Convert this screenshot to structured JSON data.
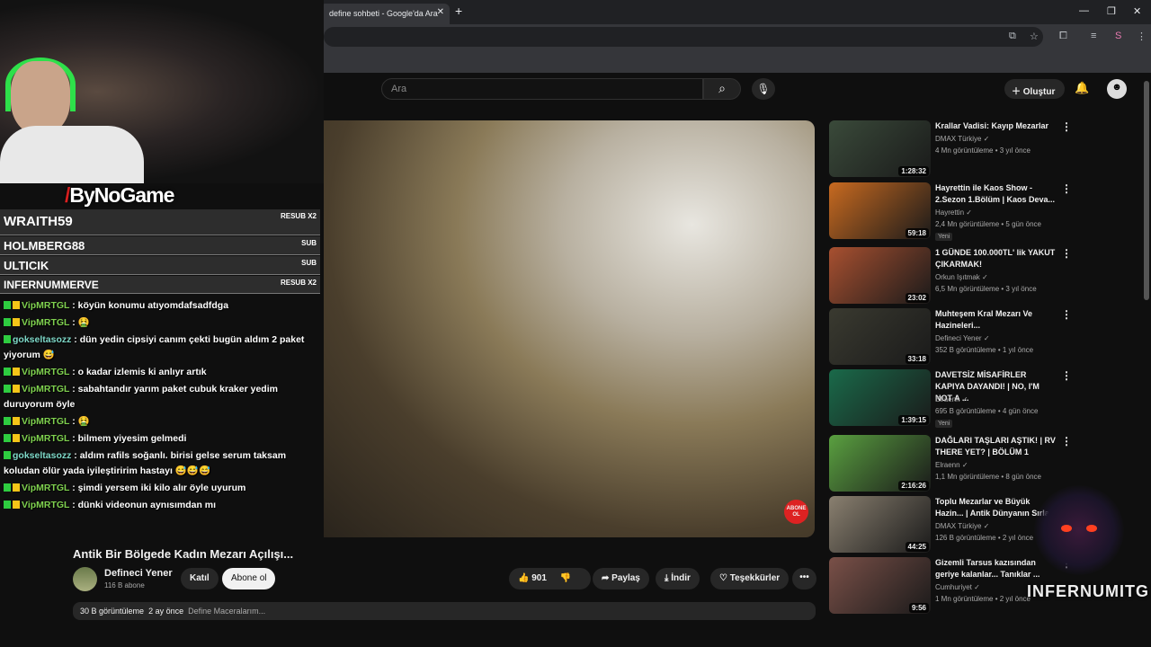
{
  "browser": {
    "tab_title": "define sohbeti - Google'da Ara",
    "tab_close": "✕",
    "new_tab": "+"
  },
  "youtube": {
    "search_placeholder": "Ara",
    "create_label": "Oluştur"
  },
  "video": {
    "title": "Antik Bir Bölgede Kadın Mezarı Açılışı...",
    "channel": "Defineci Yener",
    "subscribers": "116 B abone",
    "join_label": "Katıl",
    "subscribe_label": "Abone ol",
    "likes": "901",
    "share_label": "Paylaş",
    "download_label": "İndir",
    "thanks_label": "Teşekkürler",
    "views": "30 B görüntüleme",
    "age": "2 ay önce",
    "description": "Define Maceralarım...",
    "overlay_badge": "ABONE OL"
  },
  "recommendations": [
    {
      "title": "Krallar Vadisi: Kayıp Mezarlar",
      "channel": "DMAX Türkiye",
      "meta": "4 Mn görüntüleme • 3 yıl önce",
      "duration": "1:28:32",
      "badge": "",
      "thumb": "#3a4a3a"
    },
    {
      "title": "Hayrettin ile Kaos Show - 2.Sezon 1.Bölüm | Kaos Deva...",
      "channel": "Hayrettin",
      "meta": "2,4 Mn görüntüleme • 5 gün önce",
      "duration": "59:18",
      "badge": "Yeni",
      "thumb": "#c86a20"
    },
    {
      "title": "1 GÜNDE 100.000TL' lik YAKUT ÇIKARMAK!",
      "channel": "Orkun Işıtmak",
      "meta": "6,5 Mn görüntüleme • 3 yıl önce",
      "duration": "23:02",
      "badge": "",
      "thumb": "#a85030"
    },
    {
      "title": "Muhteşem Kral Mezarı Ve Hazineleri...",
      "channel": "Defineci Yener",
      "meta": "352 B görüntüleme • 1 yıl önce",
      "duration": "33:18",
      "badge": "",
      "thumb": "#3a3a30"
    },
    {
      "title": "DAVETSİZ MİSAFİRLER KAPIYA DAYANDI! | NO, I'M NOT A ...",
      "channel": "Elraenn",
      "meta": "695 B görüntüleme • 4 gün önce",
      "duration": "1:39:15",
      "badge": "Yeni",
      "thumb": "#1a6a4a"
    },
    {
      "title": "DAĞLARI TAŞLARI AŞTIK! | RV THERE YET? | BÖLÜM 1",
      "channel": "Elraenn",
      "meta": "1,1 Mn görüntüleme • 8 gün önce",
      "duration": "2:16:26",
      "badge": "",
      "thumb": "#5aa040"
    },
    {
      "title": "Toplu Mezarlar ve Büyük Hazin... | Antik Dünyanın Sırları",
      "channel": "DMAX Türkiye",
      "meta": "126 B görüntüleme • 2 yıl önce",
      "duration": "44:25",
      "badge": "",
      "thumb": "#8a8070"
    },
    {
      "title": "Gizemli Tarsus kazısından geriye kalanlar... Tanıklar ...",
      "channel": "Cumhuriyet",
      "meta": "1 Mn görüntüleme • 2 yıl önce",
      "duration": "9:56",
      "badge": "",
      "thumb": "#7a5048"
    }
  ],
  "stream": {
    "brand_prefix": "/",
    "brand": "ByNoGame",
    "events": [
      {
        "name": "WRAITH59",
        "tag": "RESUB X2"
      },
      {
        "name": "HOLMBERG88",
        "tag": "SUB"
      },
      {
        "name": "ULTICIK",
        "tag": "SUB"
      },
      {
        "name": "INFERNUMMERVE",
        "tag": "RESUB X2"
      }
    ],
    "chat": [
      {
        "user": "VipMRTGL",
        "badges": [
          "g",
          "y"
        ],
        "cls": "u1",
        "text": " : köyün konumu atıyomdafsadfdga"
      },
      {
        "user": "VipMRTGL",
        "badges": [
          "g",
          "y"
        ],
        "cls": "u1",
        "text": " : 🤮"
      },
      {
        "user": "gokseltasozz",
        "badges": [
          "g"
        ],
        "cls": "u2",
        "text": " : dün yedin cipsiyi canım çekti bugün aldım 2 paket yiyorum 😅"
      },
      {
        "user": "VipMRTGL",
        "badges": [
          "g",
          "y"
        ],
        "cls": "u1",
        "text": " : o kadar izlemis ki anlıyr artık"
      },
      {
        "user": "VipMRTGL",
        "badges": [
          "g",
          "y"
        ],
        "cls": "u1",
        "text": " : sabahtandır yarım paket cubuk kraker yedim duruyorum öyle"
      },
      {
        "user": "VipMRTGL",
        "badges": [
          "g",
          "y"
        ],
        "cls": "u1",
        "text": " : 🤮"
      },
      {
        "user": "VipMRTGL",
        "badges": [
          "g",
          "y"
        ],
        "cls": "u1",
        "text": " : bilmem yiyesim gelmedi"
      },
      {
        "user": "gokseltasozz",
        "badges": [
          "g"
        ],
        "cls": "u2",
        "text": " : aldım rafils soğanlı. birisi gelse serum taksam koludan ölür yada iyileştiririm hastayı 😅😅😅"
      },
      {
        "user": "VipMRTGL",
        "badges": [
          "g",
          "y"
        ],
        "cls": "u1",
        "text": " : şimdi yersem iki kilo alır öyle uyurum"
      },
      {
        "user": "VipMRTGL",
        "badges": [
          "g",
          "y"
        ],
        "cls": "u1",
        "text": " : dünki videonun aynısımdan mı"
      }
    ],
    "overlay_name": "INFERNUMITG"
  }
}
